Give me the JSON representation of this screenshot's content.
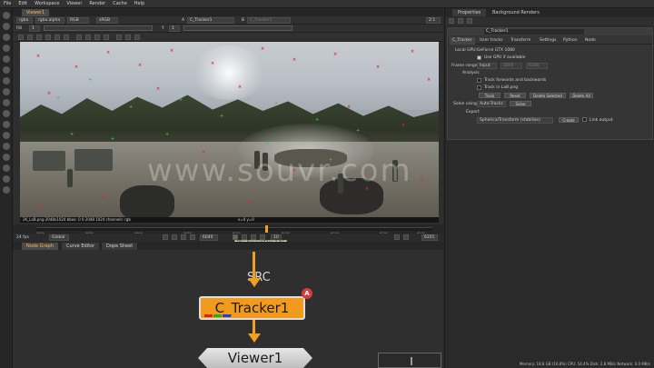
{
  "menubar": [
    "File",
    "Edit",
    "Workspace",
    "Viewer",
    "Render",
    "Cache",
    "Help"
  ],
  "viewer_tab": "Viewer1",
  "viewer_controls": {
    "channels": "rgba",
    "layer": "rgba.alpha",
    "display": "RGB",
    "colorspace": "sRGB",
    "input_a_label": "A",
    "input_a": "C_Tracker1",
    "input_b_label": "B",
    "input_b": "C_Tracker1",
    "zoom": "2:1",
    "frame_field": "1",
    "gain_label": "f/8",
    "y_label": "Y",
    "y_value": "1"
  },
  "image_info": "2K_LaB.png  2048x1024  bbox: 0 0 2048 1024  channels: rgb",
  "coords": "x=0  y=0",
  "timeline": {
    "fps_label": "24 fps",
    "range_mode": "Global",
    "ticks": [
      "5800",
      "5850",
      "5900",
      "5950",
      "6000",
      "6050",
      "6100",
      "6150",
      "6200"
    ],
    "current_frame": "6040",
    "increment": "10",
    "end_frame": "6201"
  },
  "tooltip": "Play forward/Stop (L/K)",
  "node_tabs": [
    "Node Graph",
    "Curve Editor",
    "Dope Sheet"
  ],
  "nodes": {
    "source": "SRC",
    "tracker": "C_Tracker1",
    "badge": "A",
    "viewer": "Viewer1"
  },
  "right_tabs": [
    "Properties",
    "Background Renders"
  ],
  "properties": {
    "node_name": "C_Tracker1",
    "subtabs": [
      "C_Tracker",
      "User tracks",
      "Transform",
      "Settings",
      "Python",
      "Node"
    ],
    "local_gpu_label": "Local GPU:",
    "local_gpu": "GeForce GTX 1080",
    "use_gpu": "Use GPU if available",
    "frame_range_label": "Frame range",
    "frame_range_mode": "Input",
    "frame_start": "5800",
    "frame_end": "6200",
    "analysis_label": "Analysis",
    "track_fb": "Track forwards and backwards",
    "track_lab": "Track in LaB.png",
    "buttons_row1": [
      "Track",
      "Reset",
      "Delete Selected",
      "Delete All"
    ],
    "solve_label": "Solve using",
    "solve_mode": "Auto-Tracks",
    "solve_button": "Solve",
    "export_label": "Export",
    "export_mode": "SphericalTransform (stabilise)",
    "create_button": "Create",
    "link_output": "Link output"
  },
  "status": "Memory: 18.8 GB (16.8%)  CPU: 54.4%  Disk: 2.8 MB/s  Network: 0.0 MB/s"
}
